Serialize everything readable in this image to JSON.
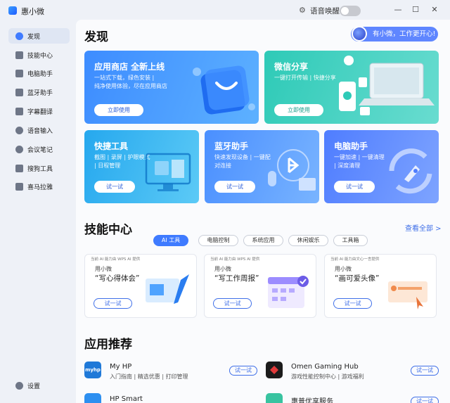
{
  "window": {
    "title": "惠小微",
    "voice_wake_label": "语音唤醒",
    "voice_wake_on": false,
    "minimize": "—",
    "maximize": "☐",
    "close": "✕"
  },
  "sidebar": {
    "items": [
      {
        "label": "发现",
        "icon": "compass-icon",
        "active": true
      },
      {
        "label": "技能中心",
        "icon": "layers-icon",
        "active": false
      },
      {
        "label": "电脑助手",
        "icon": "monitor-icon",
        "active": false
      },
      {
        "label": "蓝牙助手",
        "icon": "bluetooth-icon",
        "active": false
      },
      {
        "label": "字幕翻译",
        "icon": "subtitle-icon",
        "active": false
      },
      {
        "label": "语音输入",
        "icon": "microphone-icon",
        "active": false
      },
      {
        "label": "会议笔记",
        "icon": "people-icon",
        "active": false
      },
      {
        "label": "搜狗工具",
        "icon": "tools-icon",
        "active": false
      },
      {
        "label": "喜马拉雅",
        "icon": "book-icon",
        "active": false
      }
    ],
    "settings_label": "设置"
  },
  "discover": {
    "title": "发现",
    "assistant_bubble": "有小微，工作更开心!",
    "cards": [
      {
        "title": "应用商店 全新上线",
        "desc": [
          "一站式下载，绿色安装 |",
          "纯净使用体验，尽在应用商店"
        ],
        "button": "立即使用"
      },
      {
        "title": "微信分享",
        "desc": [
          "一键打开传输 | 快捷分享"
        ],
        "button": "立即使用"
      },
      {
        "title": "快捷工具",
        "desc": [
          "截图 | 录屏 | 护眼模式",
          "| 日程管理"
        ],
        "button": "试一试"
      },
      {
        "title": "蓝牙助手",
        "desc": [
          "快速发现设备 | 一键配",
          "对连接"
        ],
        "button": "试一试"
      },
      {
        "title": "电脑助手",
        "desc": [
          "一键加速 | 一键清理",
          "| 深度清理"
        ],
        "button": "试一试"
      }
    ]
  },
  "skills": {
    "title": "技能中心",
    "view_all": "查看全部 >",
    "tabs": [
      "AI 工具",
      "电脑控制",
      "系统应用",
      "休闲娱乐",
      "工具箱"
    ],
    "active_tab": 0,
    "cards": [
      {
        "tag": "当前 AI 能力由 WPS AI 提供",
        "use": "用小微",
        "title": "“写心得体会”",
        "button": "试一试"
      },
      {
        "tag": "当前 AI 能力由 WPS AI 提供",
        "use": "用小微",
        "title": "“写工作周报”",
        "button": "试一试"
      },
      {
        "tag": "当前 AI 能力由文心一言提供",
        "use": "用小微",
        "title": "“画可爱头像”",
        "button": "试一试"
      }
    ]
  },
  "apps": {
    "title": "应用推荐",
    "items": [
      {
        "name": "My HP",
        "desc": "入门指南 | 精选优惠 | 打印管理",
        "button": "试一试",
        "icon_text": "myhp"
      },
      {
        "name": "Omen Gaming Hub",
        "desc": "游戏性能控制中心 | 游戏福利",
        "button": "试一试",
        "icon_text": ""
      },
      {
        "name": "HP Smart",
        "desc": "",
        "button": "",
        "icon_text": ""
      },
      {
        "name": "惠普优享服务",
        "desc": "",
        "button": "试一试",
        "icon_text": ""
      }
    ]
  },
  "colors": {
    "accent": "#3f7bff",
    "card_store": "#4c9bff",
    "card_wechat": "#3fd0c2",
    "card_tools": "#2fb1f0",
    "card_bt": "#4f9dff",
    "card_pc": "#5b8cff"
  }
}
